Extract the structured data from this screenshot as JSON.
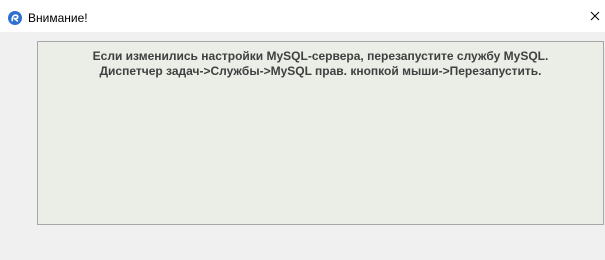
{
  "window": {
    "title": "Внимание!",
    "icon": "app-logo-icon",
    "close_glyph": "×"
  },
  "message": {
    "line1": "Если изменились настройки MySQL-сервера, перезапустите службу MySQL.",
    "line2": "Диспетчер задач->Службы->MySQL прав. кнопкой мыши->Перезапустить."
  },
  "colors": {
    "icon_blue": "#2f6fd0",
    "panel_background": "#eaeee6",
    "panel_border": "#a7a7a7",
    "text": "#404040"
  }
}
